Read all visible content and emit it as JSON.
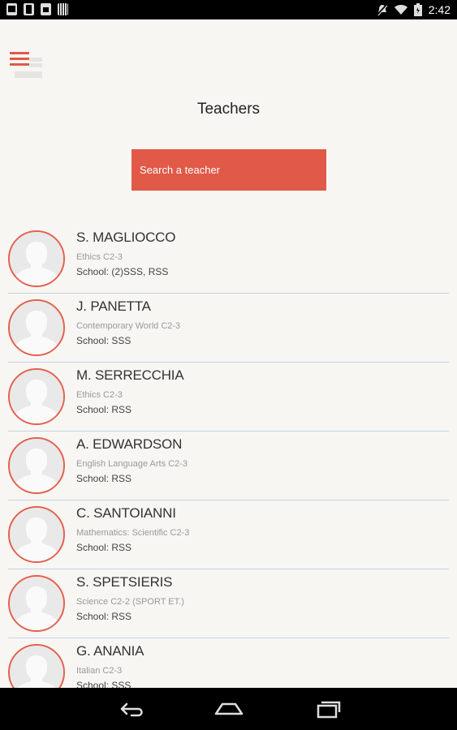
{
  "status_bar": {
    "time": "2:42",
    "icons": [
      "image-icon",
      "phone-icon",
      "bag-icon",
      "barcode-icon",
      "no-sound-icon",
      "wifi-icon",
      "battery-icon"
    ]
  },
  "colors": {
    "accent": "#e05a47",
    "background": "#f7f6f3",
    "divider": "#c8d3e6"
  },
  "header": {
    "menu_icon": "hamburger-menu-icon",
    "title": "Teachers"
  },
  "search": {
    "placeholder": "Search a teacher",
    "value": ""
  },
  "teachers": [
    {
      "name": "S. MAGLIOCCO",
      "subject": "Ethics C2-3",
      "school": "School: (2)SSS, RSS"
    },
    {
      "name": "J. PANETTA",
      "subject": "Contemporary World C2-3",
      "school": "School: SSS"
    },
    {
      "name": "M. SERRECCHIA",
      "subject": "Ethics C2-3",
      "school": "School: RSS"
    },
    {
      "name": "A. EDWARDSON",
      "subject": "English Language Arts C2-3",
      "school": "School: RSS"
    },
    {
      "name": "C. SANTOIANNI",
      "subject": "Mathematics: Scientific C2-3",
      "school": "School: RSS"
    },
    {
      "name": "S. SPETSIERIS",
      "subject": "Science C2-2 (SPORT ET.)",
      "school": "School: RSS"
    },
    {
      "name": "G. ANANIA",
      "subject": "Italian C2-3",
      "school": "School: SSS"
    }
  ],
  "nav_bar": {
    "icons": [
      "back-icon",
      "home-icon",
      "recents-icon"
    ]
  }
}
